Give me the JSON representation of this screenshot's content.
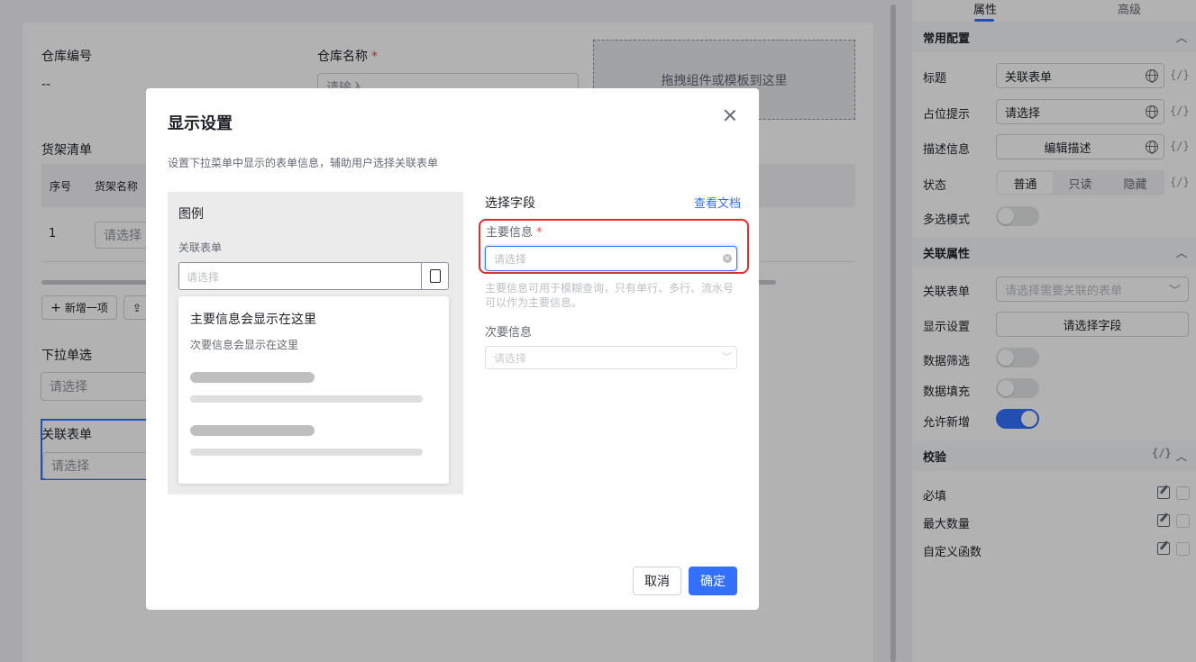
{
  "canvas": {
    "warehouse_no_label": "仓库编号",
    "warehouse_no_value": "--",
    "warehouse_name_label": "仓库名称",
    "required_mark": "*",
    "warehouse_name_placeholder": "请输入",
    "drop_zone_text": "拖拽组件或模板到这里",
    "shelf_list_title": "货架清单",
    "table_headers": [
      "序号",
      "货架名称"
    ],
    "row_index": "1",
    "row_select_placeholder": "请选择",
    "add_item_label": "新增一项",
    "dropdown_single_label": "下拉单选",
    "dropdown_single_placeholder": "请选择",
    "linked_form_label": "关联表单",
    "linked_form_placeholder": "请选择"
  },
  "right_panel": {
    "tabs": [
      "属性",
      "高级"
    ],
    "active_tab": "属性",
    "section_common": "常用配置",
    "title_label": "标题",
    "title_value": "关联表单",
    "placeholder_label": "占位提示",
    "placeholder_value": "请选择",
    "desc_label": "描述信息",
    "desc_button": "编辑描述",
    "fx": "{/}",
    "status_label": "状态",
    "status_options": [
      "普通",
      "只读",
      "隐藏"
    ],
    "status_active": "普通",
    "multi_label": "多选模式",
    "multi_on": false,
    "section_link": "关联属性",
    "link_form_label": "关联表单",
    "link_form_placeholder": "请选择需要关联的表单",
    "display_label": "显示设置",
    "display_button": "请选择字段",
    "filter_label": "数据筛选",
    "filter_on": false,
    "fill_label": "数据填充",
    "fill_on": false,
    "allow_new_label": "允许新增",
    "allow_new_on": true,
    "section_validate": "校验",
    "required_label": "必填",
    "max_label": "最大数量",
    "custom_fn_label": "自定义函数"
  },
  "modal": {
    "title": "显示设置",
    "subtitle": "设置下拉菜单中显示的表单信息，辅助用户选择关联表单",
    "legend_title": "图例",
    "legend_field_label": "关联表单",
    "legend_placeholder": "请选择",
    "legend_primary": "主要信息会显示在这里",
    "legend_secondary": "次要信息会显示在这里",
    "select_field_title": "选择字段",
    "view_docs": "查看文档",
    "primary_label": "主要信息",
    "required_mark": "*",
    "primary_placeholder": "请选择",
    "primary_hint": "主要信息可用于模糊查询，只有单行、多行、流水号可以作为主要信息。",
    "secondary_label": "次要信息",
    "secondary_placeholder": "请选择",
    "cancel_label": "取消",
    "ok_label": "确定"
  },
  "colors": {
    "accent": "#3370ff",
    "highlight_box": "#e02c2c",
    "required": "#f54a45"
  }
}
